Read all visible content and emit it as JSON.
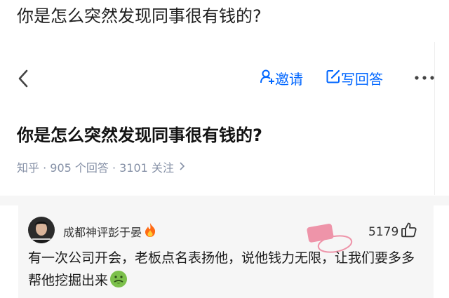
{
  "page": {
    "heading": "你是怎么突然发现同事很有钱的?"
  },
  "topbar": {
    "invite_label": "邀请",
    "write_label": "写回答",
    "icons": [
      "back-arrow-icon",
      "user-icon",
      "edit-icon",
      "more-icon"
    ]
  },
  "question": {
    "title": "你是怎么突然发现同事很有钱的?",
    "meta": "知乎 · 905 个回答 · 3101 关注"
  },
  "comment": {
    "author": "成都神评彭于晏",
    "likes": "5179",
    "text": "有一次公司开会，老板点名表扬他，说他钱力无限，让我们要多多帮他挖掘出来",
    "icons": [
      "fire-emoji-icon",
      "thumbs-up-icon",
      "sick-face-emoji-icon"
    ]
  },
  "watermark": {
    "text_top": "神评",
    "text_bottom": "皮皮虾"
  },
  "colors": {
    "accent": "#0066ff",
    "meta_gray": "#8590a6",
    "comment_bg": "#f6f6f6",
    "stamp": "#e8456b"
  }
}
